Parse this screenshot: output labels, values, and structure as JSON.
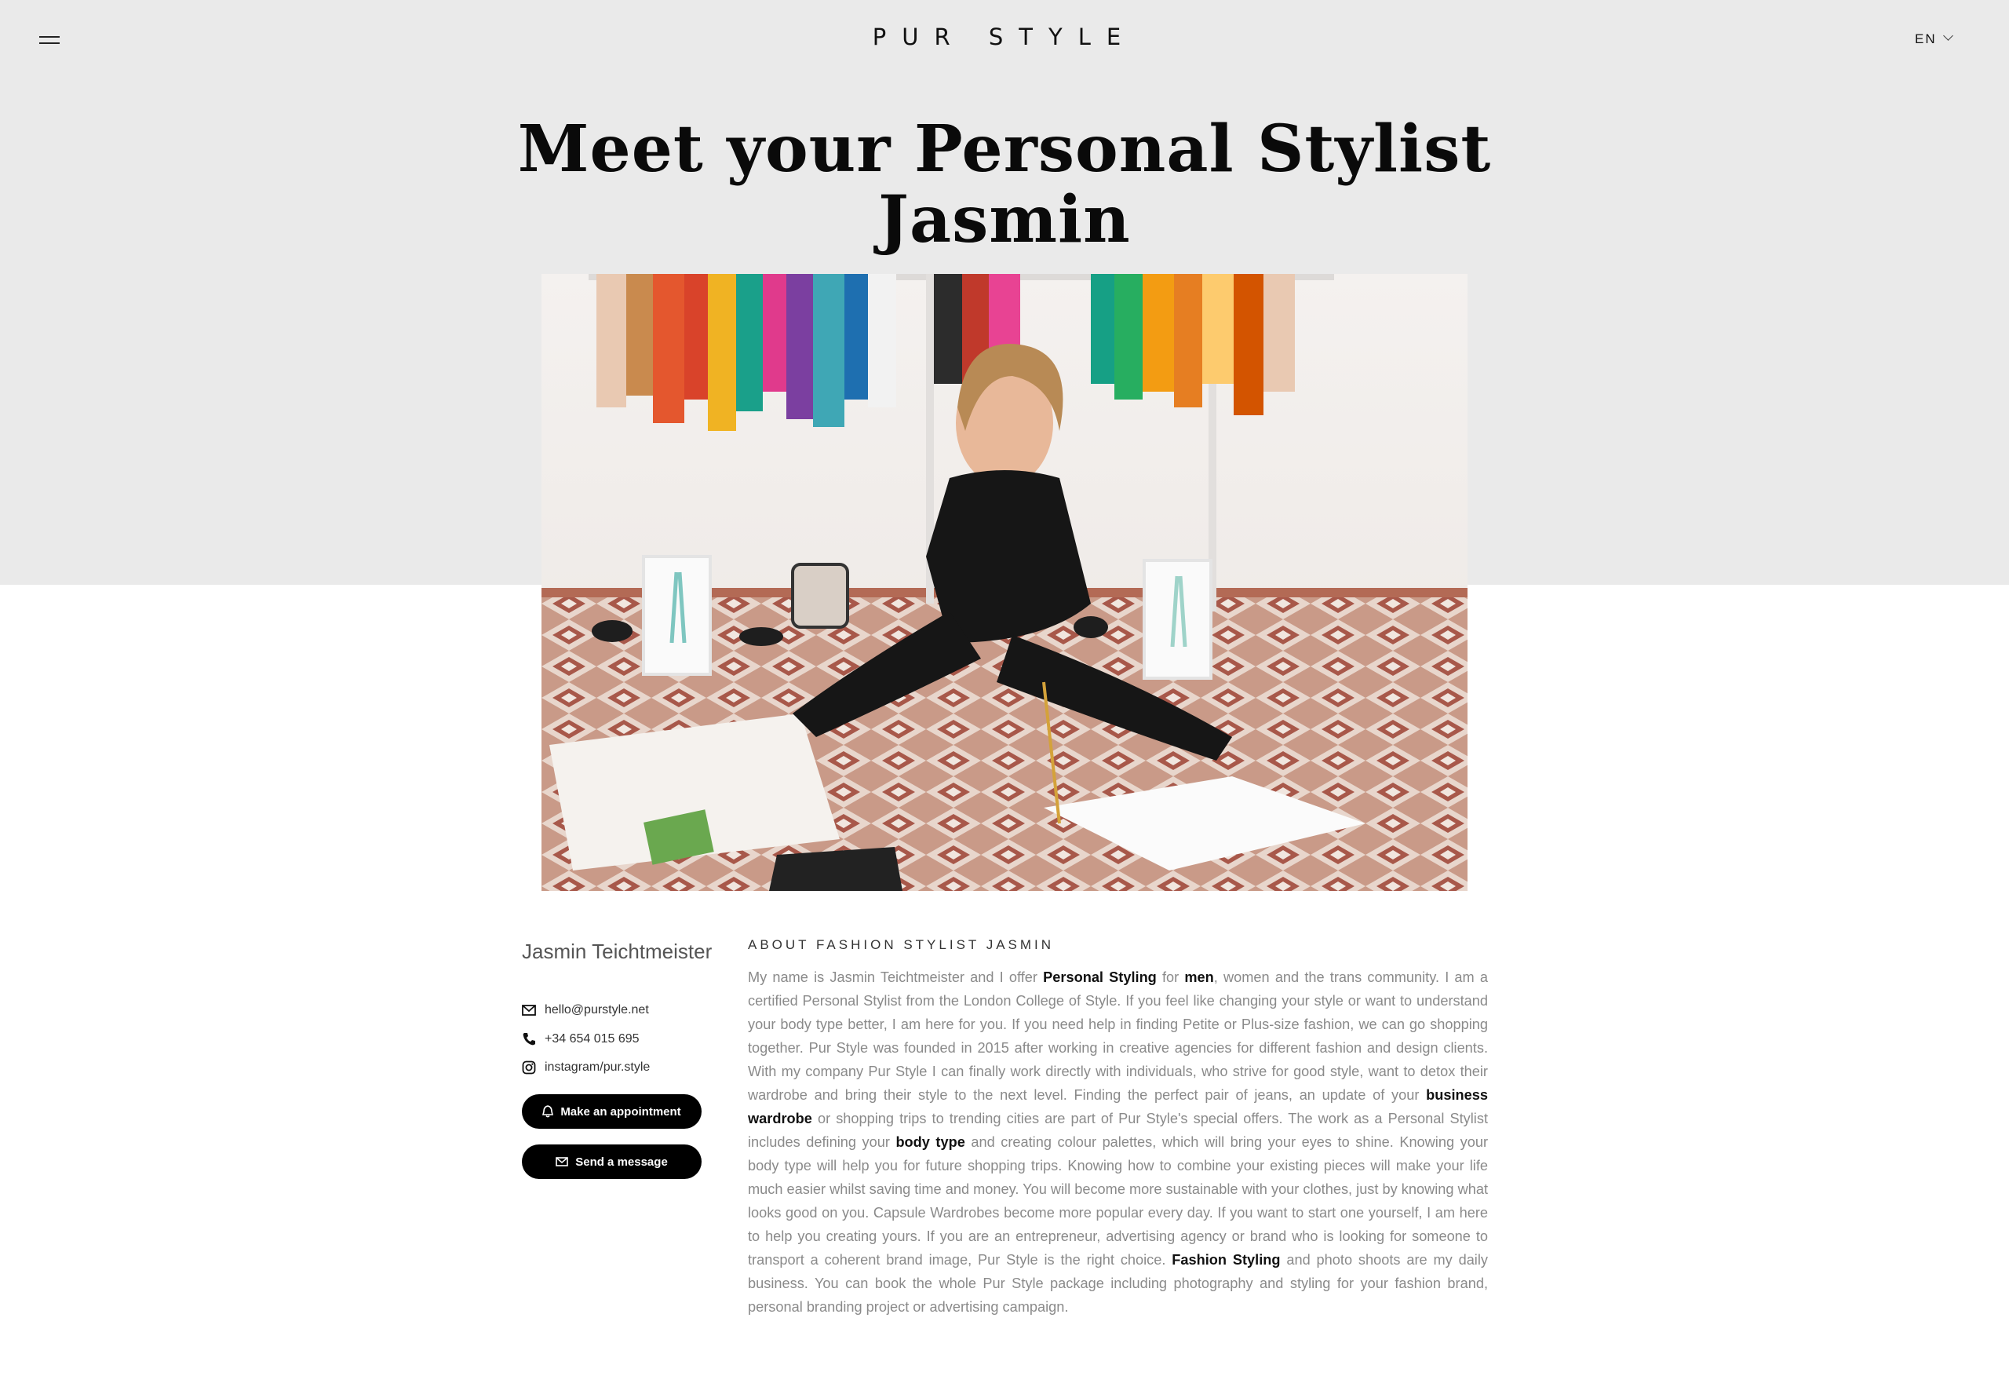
{
  "header": {
    "menu_icon": "hamburger-menu-icon",
    "logo": "PUR STYLE",
    "language": "EN",
    "language_icon": "chevron-down-icon"
  },
  "hero": {
    "title_line1": "Meet your Personal Stylist",
    "title_line2": "Jasmin",
    "photo_icon": "stylist-photo"
  },
  "profile": {
    "name": "Jasmin Teichtmeister",
    "email": "hello@purstyle.net",
    "email_icon": "envelope-icon",
    "phone": "+34 654 015 695",
    "phone_icon": "phone-icon",
    "instagram": "instagram/pur.style",
    "instagram_icon": "instagram-icon",
    "appointment_label": "Make an appointment",
    "appointment_icon": "bell-icon",
    "message_label": "Send a message",
    "message_icon": "envelope-icon"
  },
  "about": {
    "heading": "ABOUT FASHION STYLIST JASMIN",
    "p1": "My name is Jasmin Teichtmeister and I offer ",
    "k1": "Personal Styling",
    "p2": " for ",
    "k2": "men",
    "p3": ", women and the trans community. I am a certified Personal Stylist from the London College of Style. If you feel like changing your style or want to understand your body type better, I am here for you. If you need help in finding Petite or Plus-size fashion, we can go shopping together.  Pur Style was founded in 2015 after working in creative agencies for different fashion and design clients. With my company Pur Style I can finally work directly with individuals, who strive for good style, want to detox their wardrobe and bring their style to the next level. Finding the perfect pair of jeans, an update of your ",
    "k3": "business wardrobe",
    "p4": " or shopping trips to trending cities are part of Pur Style's special offers. The work as a Personal Stylist includes defining your ",
    "k4": "body type",
    "p5": " and creating colour palettes, which will bring your eyes to shine. Knowing your body type will help you for future shopping trips. Knowing how to combine your existing pieces will make your life much easier whilst saving time and money. You will become more sustainable with your clothes, just by knowing what looks good on you. Capsule Wardrobes become more popular every day. If you want to start one yourself, I am here to help you creating yours. If you are an entrepreneur, advertising agency or brand who is looking for someone to transport a coherent brand image, Pur Style is the right choice. ",
    "k5": "Fashion Styling",
    "p6": " and photo shoots are my daily business. You can book the whole Pur Style package including photography and styling for your fashion brand, personal branding project or advertising campaign."
  },
  "colors": {
    "band": "#eaeaea",
    "button": "#000000",
    "body_text": "#8a8a8a",
    "keyword_text": "#111111"
  }
}
